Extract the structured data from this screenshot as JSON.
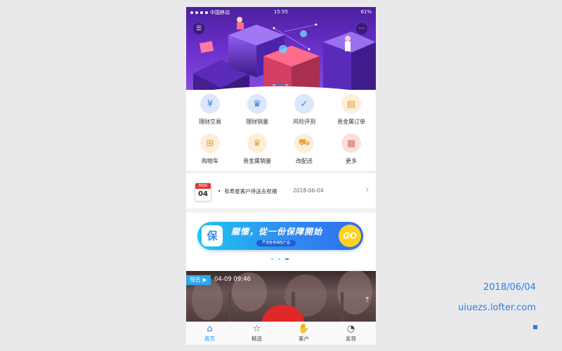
{
  "status_bar": {
    "carrier": "中国移动",
    "time": "15:55",
    "battery": "61%"
  },
  "hero": {
    "menu_icon": "menu-icon",
    "message_icon": "message-icon",
    "carousel_page": 2,
    "carousel_total": 3
  },
  "grid": {
    "items": [
      {
        "label": "理财交易",
        "icon": "yen-coin-icon",
        "bg": "#dbe7fb",
        "fg": "#3d7be0"
      },
      {
        "label": "理财销量",
        "icon": "trophy-icon",
        "bg": "#dbe7fb",
        "fg": "#3d7be0"
      },
      {
        "label": "风险评测",
        "icon": "shield-check-icon",
        "bg": "#dbe7fb",
        "fg": "#3d7be0"
      },
      {
        "label": "贵金属订单",
        "icon": "gold-bars-icon",
        "bg": "#fbefd9",
        "fg": "#e0a33d"
      },
      {
        "label": "购物车",
        "icon": "cart-icon",
        "bg": "#fbefd9",
        "fg": "#e0a33d"
      },
      {
        "label": "贵金属销量",
        "icon": "trophy-icon",
        "bg": "#fbefd9",
        "fg": "#e0a33d"
      },
      {
        "label": "改配送",
        "icon": "truck-icon",
        "bg": "#fbefd9",
        "fg": "#e0a33d"
      },
      {
        "label": "更多",
        "icon": "more-grid-icon",
        "bg": "#fbe0e0",
        "fg": "#e06b6b"
      }
    ]
  },
  "notice": {
    "cal_weekday": "MON",
    "cal_day": "04",
    "text": "有寿星客户待送去祝福",
    "date": "2018-06-04"
  },
  "banner": {
    "shield_char": "保",
    "title": "關懷，從一份保障開始",
    "subtitle": "严选各类保险产品",
    "go": "GO",
    "carousel_page": 3,
    "carousel_total": 3
  },
  "video": {
    "tag": "预告",
    "time": "04-09 09:46"
  },
  "tabbar": {
    "tabs": [
      {
        "label": "首页",
        "icon": "home-icon"
      },
      {
        "label": "精选",
        "icon": "star-icon"
      },
      {
        "label": "客户",
        "icon": "handshake-icon"
      },
      {
        "label": "发现",
        "icon": "compass-icon"
      }
    ],
    "active": 0
  },
  "watermark": {
    "date": "2018/06/04",
    "site": "uiuezs.lofter.com"
  },
  "colors": {
    "accent": "#2a8ff0",
    "hero_purple": "#6a2fc9"
  }
}
